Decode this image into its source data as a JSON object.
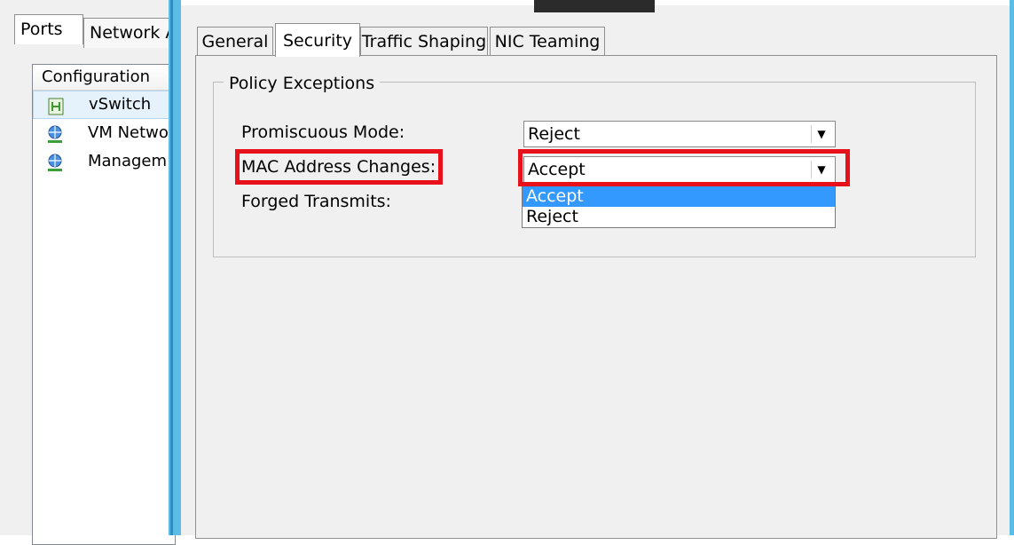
{
  "left_panel": {
    "tabs": [
      "Ports",
      "Network A"
    ],
    "list_header": "Configuration",
    "items": [
      {
        "label": "vSwitch",
        "icon": "vswitch-icon"
      },
      {
        "label": "VM Netwo",
        "icon": "network-globe-icon"
      },
      {
        "label": "Managem",
        "icon": "network-globe-icon"
      }
    ]
  },
  "dialog": {
    "tabs": [
      "General",
      "Security",
      "Traffic Shaping",
      "NIC Teaming"
    ],
    "active_tab": "Security",
    "group_title": "Policy Exceptions",
    "fields": {
      "promiscuous": {
        "label": "Promiscuous Mode:",
        "value": "Reject"
      },
      "mac": {
        "label": "MAC Address Changes:",
        "value": "Accept"
      },
      "forged": {
        "label": "Forged Transmits:"
      }
    },
    "dropdown_options": [
      "Accept",
      "Reject"
    ],
    "dropdown_highlighted": "Accept"
  },
  "colors": {
    "highlight_box": "#e8101a",
    "selection_blue": "#3399ff",
    "frame_blue": "#5bbde6"
  }
}
